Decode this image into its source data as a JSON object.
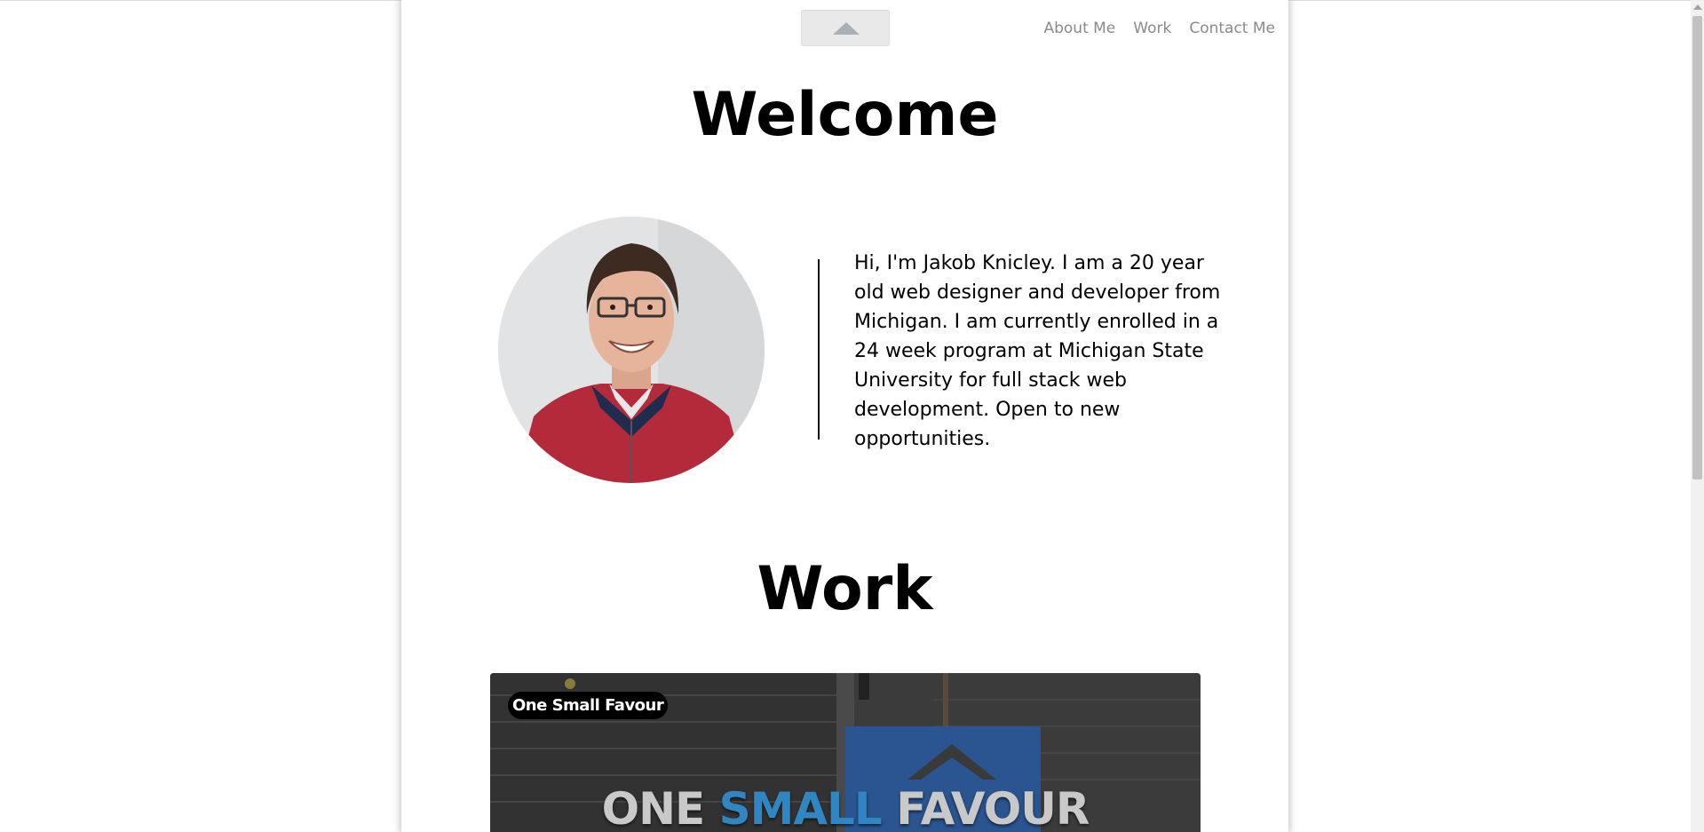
{
  "header": {
    "scroll_top_button": "scroll-to-top",
    "nav": [
      {
        "label": "About Me"
      },
      {
        "label": "Work"
      },
      {
        "label": "Contact Me"
      }
    ]
  },
  "about": {
    "title": "Welcome",
    "bio": "Hi, I'm Jakob Knicley. I am a 20 year old web designer and developer from Michigan. I am currently enrolled in a 24 week program at Michigan State University for full stack web development. Open to new opportunities."
  },
  "work": {
    "title": "Work",
    "projects": [
      {
        "name": "One Small Favour",
        "logo_words": [
          "ONE",
          "SMALL",
          "FAVOUR"
        ],
        "logo_colors": [
          "#c9c9c9",
          "#2f86c3",
          "#c9c9c9"
        ]
      }
    ]
  },
  "colors": {
    "nav_link": "#8a8a8a",
    "page_bg": "#ffffff",
    "accent_blue": "#2f86c3"
  }
}
